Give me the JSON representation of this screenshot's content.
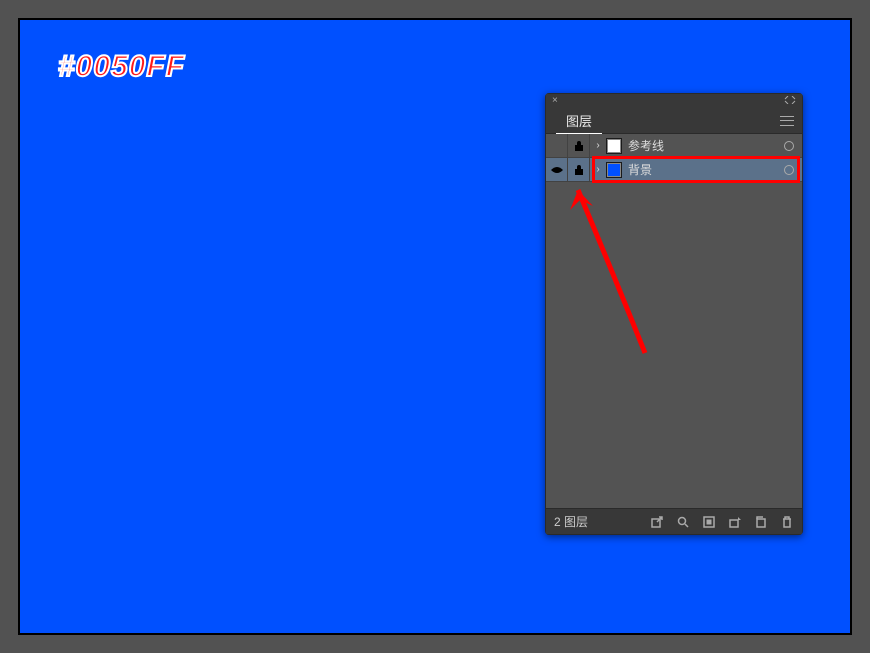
{
  "canvas": {
    "color_label": "#0050FF",
    "fill": "#0050FF"
  },
  "layers_panel": {
    "tab_label": "图层",
    "rows": [
      {
        "name": "参考线",
        "swatch": "#ffffff",
        "visible": false,
        "locked": true,
        "selected": false
      },
      {
        "name": "背景",
        "swatch": "#0050FF",
        "visible": true,
        "locked": true,
        "selected": true
      }
    ],
    "footer_count": "2 图层"
  }
}
